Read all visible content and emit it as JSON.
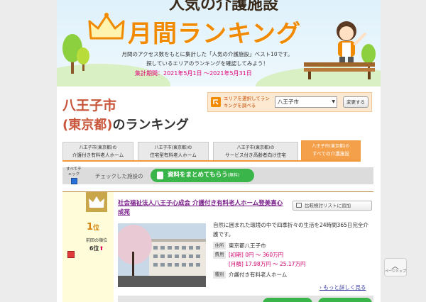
{
  "banner": {
    "top_title": "人気の介護施設",
    "ranking_title": "月間ランキング",
    "description_line1": "月間のアクセス数をもとに集計した「人気の介護施設」ベスト10",
    "description_suffix": "です。",
    "description_line2": "探しているエリアのランキングを確認してみよう！",
    "period": "集計期間：2021年5月1日 〜2021年5月31日"
  },
  "heading": {
    "city": "八王子市",
    "pref": "(東京都)",
    "suffix": "のランキング"
  },
  "area_selector": {
    "label": "エリアを選択してランキングを調べる",
    "selected": "八王子市",
    "change_label": "変更する"
  },
  "tabs": [
    {
      "line1": "八王子市(東京都)の",
      "line2": "介護付き有料老人ホーム",
      "active": false
    },
    {
      "line1": "八王子市(東京都)の",
      "line2": "住宅型有料老人ホーム",
      "active": false
    },
    {
      "line1": "八王子市(東京都)の",
      "line2": "サービス付き高齢者向け住宅",
      "active": false
    },
    {
      "line1": "八王子市(東京都)の",
      "line2": "すべての介護施設",
      "active": true
    }
  ],
  "check_bar": {
    "all_check_label": "すべてチェック",
    "checked_label": "チェックした施設の",
    "collect_label": "資料をまとめてもらう",
    "free_label": "(無料)"
  },
  "card": {
    "rank": "1",
    "rank_unit": "位",
    "prev_label": "前回の順位",
    "prev_rank": "6位",
    "name": "社会福祉法人八王子心成会 介護付き有料老人ホーム登美喜心成苑",
    "compare_label": "比較検討リストに追加",
    "summary": "自然に囲まれた環境の中で四季折々の生活を24時間365日完全介護です。",
    "address_label": "住所",
    "address": "東京都八王子市",
    "cost_label": "費用",
    "initial_cost": "[初期] 0円 〜 360万円",
    "monthly_cost": "[月額] 17.98万円 〜 25.17万円",
    "type_label": "種別",
    "type": "介護付き有料老人ホーム",
    "more_label": "もっと詳しく見る"
  },
  "page_top": {
    "label": "ページトップ"
  },
  "colors": {
    "accent": "#f08a00",
    "pink": "#e2007a",
    "green": "#3ab54a",
    "purple": "#7a1f8a"
  }
}
